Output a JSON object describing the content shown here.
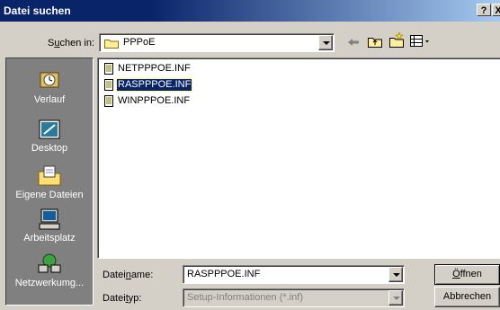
{
  "window": {
    "title": "Datei suchen",
    "help": "?",
    "close": "X"
  },
  "lookin": {
    "pre": "S",
    "key": "u",
    "post": "chen in:",
    "value": "PPPoE"
  },
  "places": [
    {
      "label": "Verlauf"
    },
    {
      "label": "Desktop"
    },
    {
      "label": "Eigene Dateien"
    },
    {
      "label": "Arbeitsplatz"
    },
    {
      "label": "Netzwerkumg..."
    }
  ],
  "files": [
    {
      "name": "NETPPPOE.INF"
    },
    {
      "name": "RASPPPOE.INF"
    },
    {
      "name": "WINPPPOE.INF"
    }
  ],
  "filename": {
    "pre": "Datei",
    "key": "n",
    "post": "ame:",
    "value": "RASPPPOE.INF"
  },
  "filetype": {
    "pre": "Datei",
    "key": "t",
    "post": "yp:",
    "value": "Setup-Informationen (*.inf)"
  },
  "buttons": {
    "open_key": "Ö",
    "open_rest": "ffnen",
    "cancel": "Abbrechen"
  },
  "colors": {
    "title_start": "#0a246a",
    "title_end": "#a6caf0",
    "face": "#d4d0c8",
    "selection": "#0a246a"
  }
}
